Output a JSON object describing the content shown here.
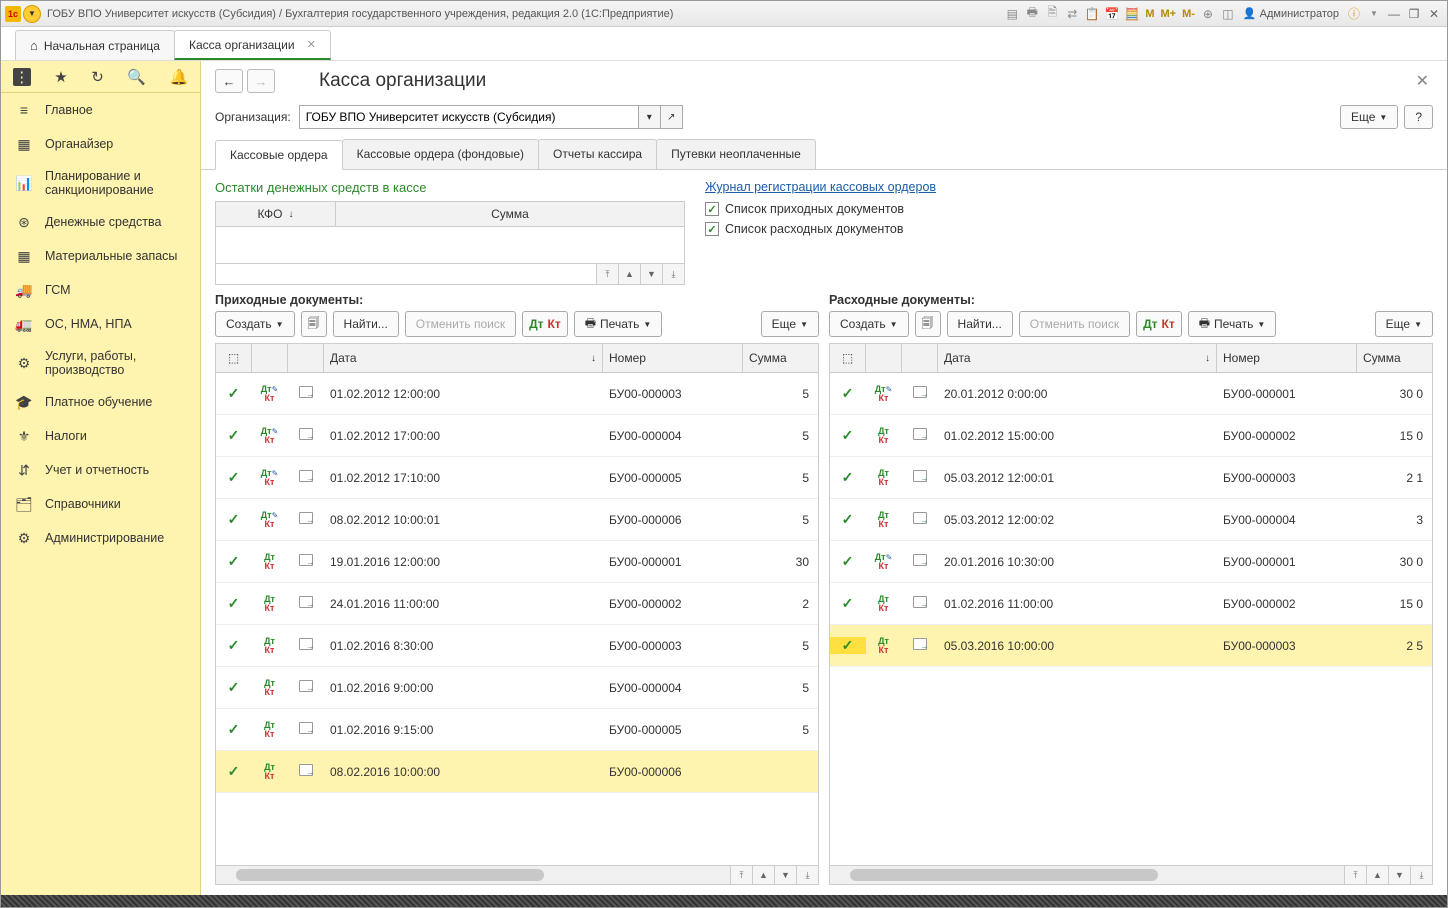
{
  "titlebar": {
    "title": "ГОБУ ВПО Университет искусств (Субсидия) / Бухгалтерия государственного учреждения, редакция 2.0  (1С:Предприятие)",
    "m": "M",
    "m_plus": "M+",
    "m_minus": "M-",
    "user": "Администратор"
  },
  "main_tabs": {
    "home": "Начальная страница",
    "cash": "Касса организации"
  },
  "sidebar": {
    "items": [
      "Главное",
      "Органайзер",
      "Планирование и санкционирование",
      "Денежные средства",
      "Материальные запасы",
      "ГСМ",
      "ОС, НМА, НПА",
      "Услуги, работы, производство",
      "Платное обучение",
      "Налоги",
      "Учет и отчетность",
      "Справочники",
      "Администрирование"
    ]
  },
  "page": {
    "title": "Касса организации",
    "org_label": "Организация:",
    "org_value": "ГОБУ ВПО Университет искусств (Субсидия)",
    "more": "Еще",
    "help": "?"
  },
  "inner_tabs": [
    "Кассовые ордера",
    "Кассовые ордера (фондовые)",
    "Отчеты кассира",
    "Путевки неоплаченные"
  ],
  "balance": {
    "title": "Остатки денежных средств в кассе",
    "kfo": "КФО",
    "sum": "Сумма"
  },
  "journal": {
    "link": "Журнал регистрации кассовых ордеров",
    "chk_income": "Список приходных документов",
    "chk_expense": "Список расходных документов"
  },
  "income": {
    "title": "Приходные документы:",
    "create": "Создать",
    "find": "Найти...",
    "cancel_search": "Отменить поиск",
    "print": "Печать",
    "more": "Еще",
    "col_date": "Дата",
    "col_num": "Номер",
    "col_sum": "Сумма",
    "rows": [
      {
        "date": "01.02.2012 12:00:00",
        "num": "БУ00-000003",
        "sum": "5",
        "pencil": true
      },
      {
        "date": "01.02.2012 17:00:00",
        "num": "БУ00-000004",
        "sum": "5",
        "pencil": true
      },
      {
        "date": "01.02.2012 17:10:00",
        "num": "БУ00-000005",
        "sum": "5",
        "pencil": true
      },
      {
        "date": "08.02.2012 10:00:01",
        "num": "БУ00-000006",
        "sum": "5",
        "pencil": true
      },
      {
        "date": "19.01.2016 12:00:00",
        "num": "БУ00-000001",
        "sum": "30",
        "pencil": false
      },
      {
        "date": "24.01.2016 11:00:00",
        "num": "БУ00-000002",
        "sum": "2",
        "pencil": false
      },
      {
        "date": "01.02.2016 8:30:00",
        "num": "БУ00-000003",
        "sum": "5",
        "pencil": false
      },
      {
        "date": "01.02.2016 9:00:00",
        "num": "БУ00-000004",
        "sum": "5",
        "pencil": false
      },
      {
        "date": "01.02.2016 9:15:00",
        "num": "БУ00-000005",
        "sum": "5",
        "pencil": false
      },
      {
        "date": "08.02.2016 10:00:00",
        "num": "БУ00-000006",
        "sum": "",
        "pencil": false,
        "selected": true
      }
    ]
  },
  "expense": {
    "title": "Расходные документы:",
    "create": "Создать",
    "find": "Найти...",
    "cancel_search": "Отменить поиск",
    "print": "Печать",
    "more": "Еще",
    "col_date": "Дата",
    "col_num": "Номер",
    "col_sum": "Сумма",
    "rows": [
      {
        "date": "20.01.2012 0:00:00",
        "num": "БУ00-000001",
        "sum": "30 0",
        "pencil": true
      },
      {
        "date": "01.02.2012 15:00:00",
        "num": "БУ00-000002",
        "sum": "15 0",
        "pencil": false
      },
      {
        "date": "05.03.2012 12:00:01",
        "num": "БУ00-000003",
        "sum": "2 1",
        "pencil": false
      },
      {
        "date": "05.03.2012 12:00:02",
        "num": "БУ00-000004",
        "sum": "3",
        "pencil": false
      },
      {
        "date": "20.01.2016 10:30:00",
        "num": "БУ00-000001",
        "sum": "30 0",
        "pencil": true
      },
      {
        "date": "01.02.2016 11:00:00",
        "num": "БУ00-000002",
        "sum": "15 0",
        "pencil": false
      },
      {
        "date": "05.03.2016 10:00:00",
        "num": "БУ00-000003",
        "sum": "2 5",
        "pencil": false,
        "selected": true,
        "strong": true
      }
    ]
  }
}
